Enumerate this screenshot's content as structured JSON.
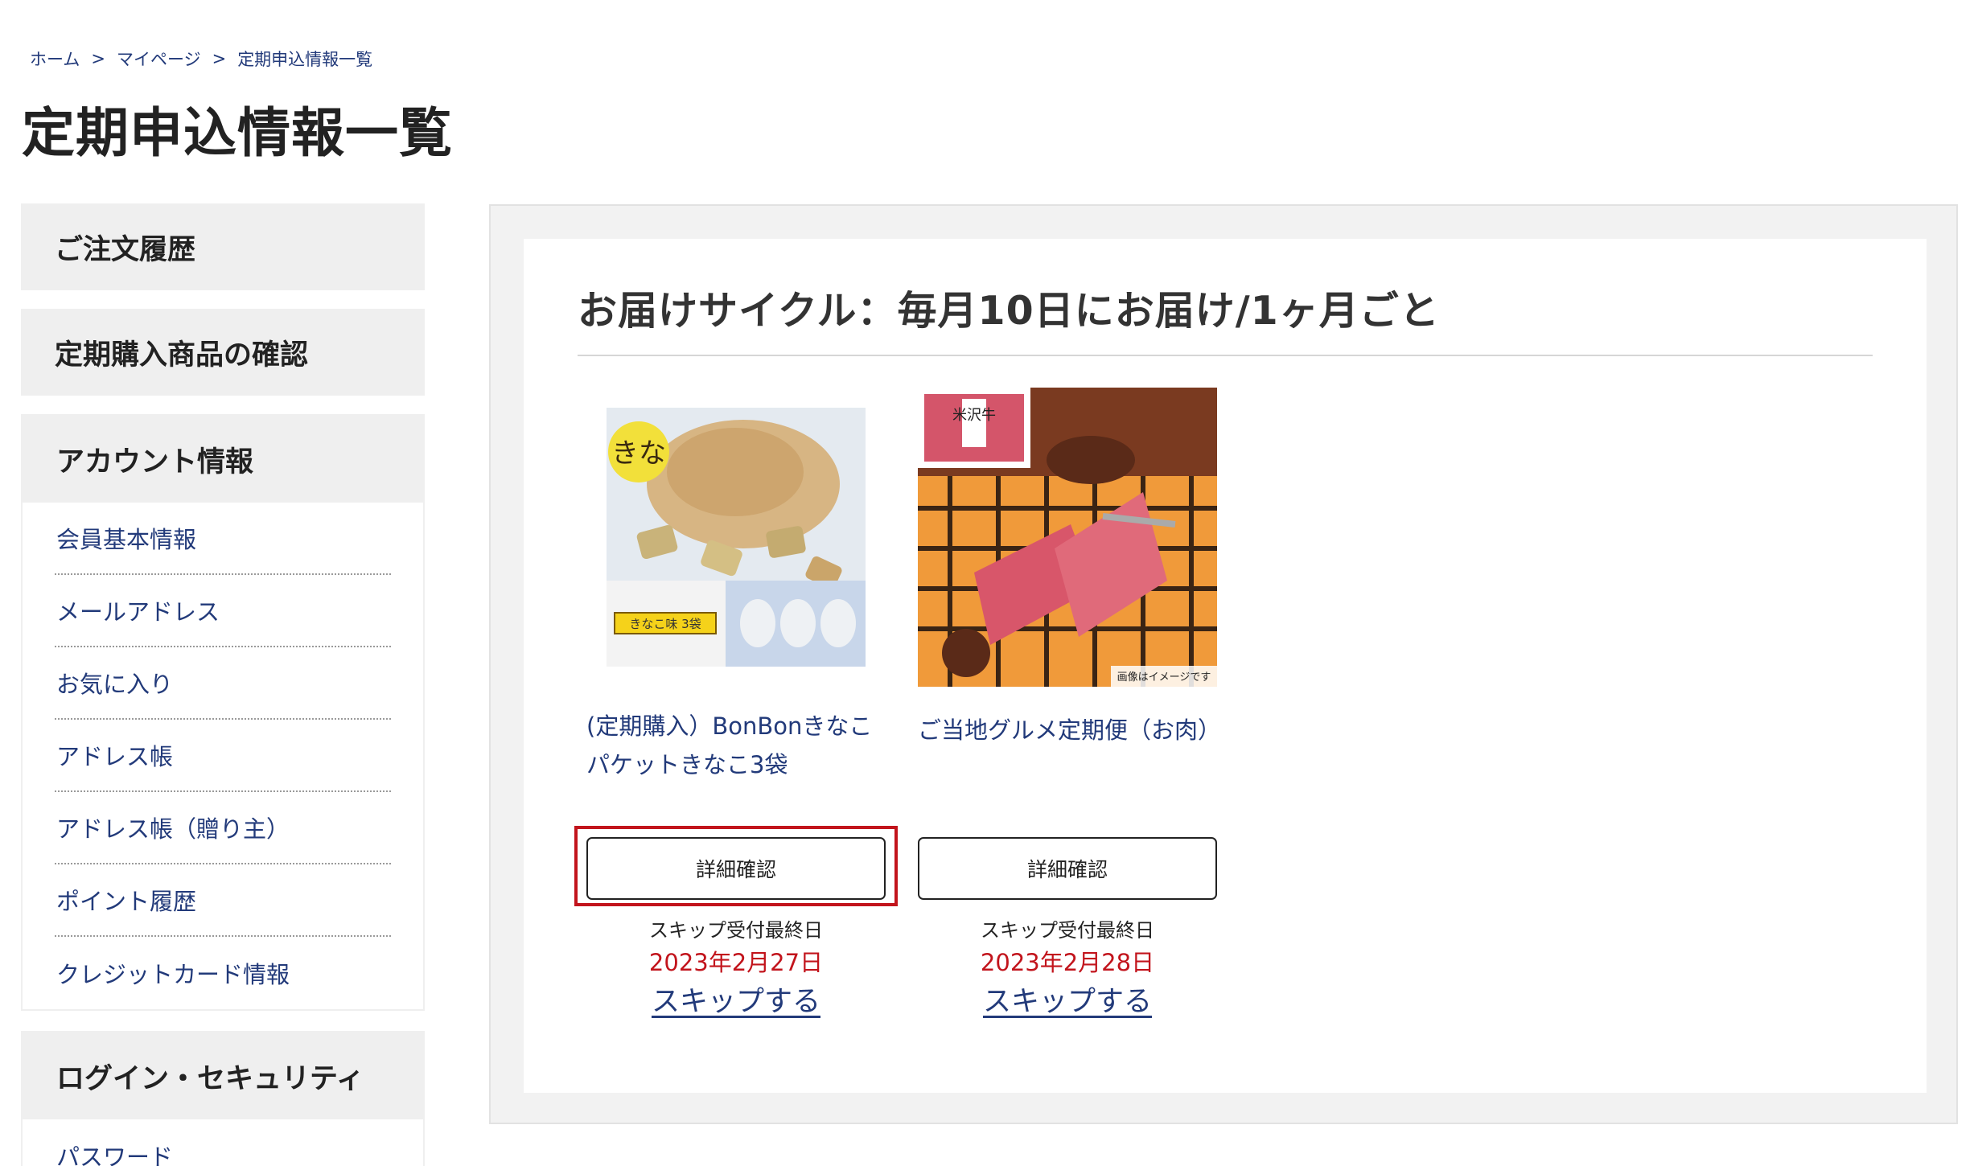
{
  "breadcrumb": {
    "items": [
      "ホーム",
      "マイページ",
      "定期申込情報一覧"
    ],
    "separator": ">"
  },
  "page_title": "定期申込情報一覧",
  "sidebar": {
    "order_history": "ご注文履歴",
    "subscription_check": "定期購入商品の確認",
    "account": {
      "heading": "アカウント情報",
      "items": [
        "会員基本情報",
        "メールアドレス",
        "お気に入り",
        "アドレス帳",
        "アドレス帳（贈り主）",
        "ポイント履歴",
        "クレジットカード情報"
      ]
    },
    "security": {
      "heading": "ログイン・セキュリティ",
      "items": [
        "パスワード"
      ]
    }
  },
  "main": {
    "cycle_title": "お届けサイクル：毎月10日にお届け/1ヶ月ごと",
    "products": [
      {
        "name": "(定期購入）BonBonきなこパケットきなこ3袋",
        "detail_button": "詳細確認",
        "skip_label": "スキップ受付最終日",
        "skip_date": "2023年2月27日",
        "skip_link": "スキップする",
        "image_text": "きなこ味 3袋"
      },
      {
        "name": "ご当地グルメ定期便（お肉）",
        "detail_button": "詳細確認",
        "skip_label": "スキップ受付最終日",
        "skip_date": "2023年2月28日",
        "skip_link": "スキップする",
        "image_text": "画像はイメージです",
        "image_label": "米沢牛"
      }
    ]
  },
  "colors": {
    "link": "#223a7a",
    "accent_red": "#c2141c",
    "panel_bg": "#f2f2f2",
    "side_head_bg": "#efefef"
  }
}
